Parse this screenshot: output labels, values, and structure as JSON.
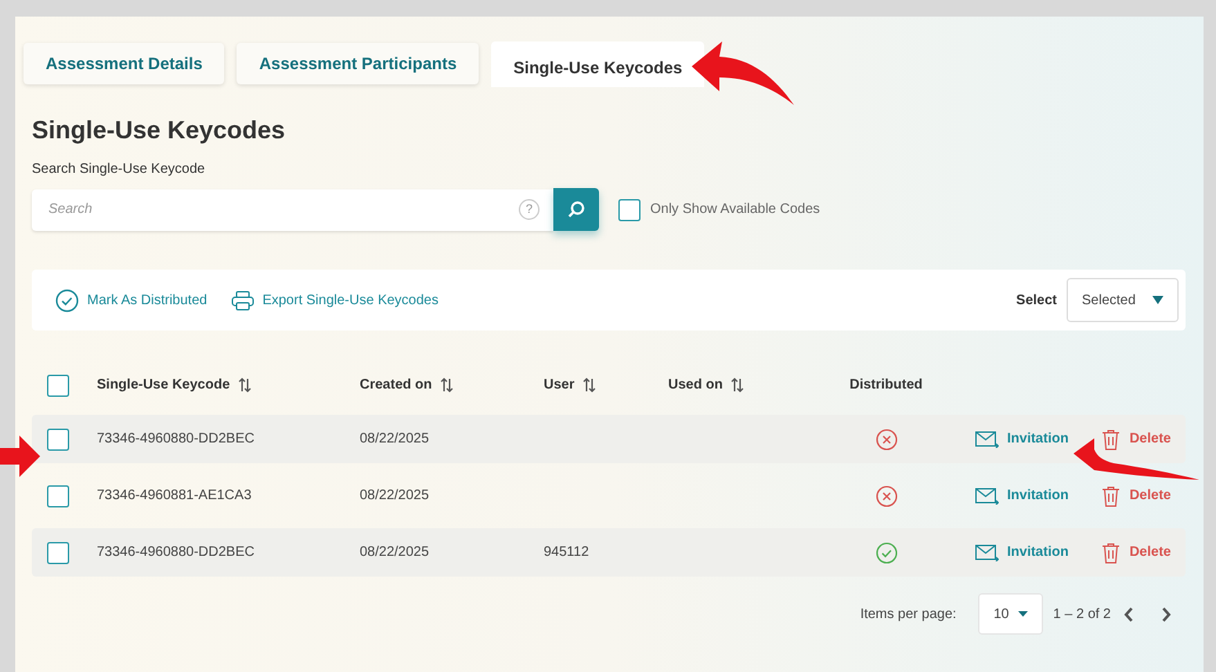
{
  "tabs": [
    {
      "label": "Assessment Details",
      "selected": false
    },
    {
      "label": "Assessment Participants",
      "selected": false
    },
    {
      "label": "Single-Use Keycodes",
      "selected": true
    }
  ],
  "title": "Single-Use Keycodes",
  "search": {
    "label": "Search Single-Use Keycode",
    "placeholder": "Search",
    "help": "?"
  },
  "only_available": {
    "label": "Only Show Available Codes",
    "checked": false
  },
  "toolbar": {
    "actions": [
      {
        "kind": "check",
        "label": "Mark As Distributed"
      },
      {
        "kind": "print",
        "label": "Export Single-Use Keycodes"
      }
    ],
    "select_label": "Select",
    "select_value": "Selected"
  },
  "table": {
    "select_all_checked": false,
    "columns": [
      {
        "label": "Single-Use Keycode",
        "sortable": true
      },
      {
        "label": "Created on",
        "sortable": true
      },
      {
        "label": "User",
        "sortable": true
      },
      {
        "label": "Used on",
        "sortable": true
      },
      {
        "label": "Distributed",
        "sortable": false
      }
    ],
    "rows": [
      {
        "checked": false,
        "keycode": "73346-4960880-DD2BEC",
        "created_on": "08/22/2025",
        "user": "",
        "distributed": false,
        "invitation": "Invitation",
        "delete": "Delete"
      },
      {
        "checked": false,
        "keycode": "73346-4960881-AE1CA3",
        "created_on": "08/22/2025",
        "user": "",
        "distributed": false,
        "invitation": "Invitation",
        "delete": "Delete"
      },
      {
        "checked": false,
        "keycode": "73346-4960880-DD2BEC",
        "created_on": "08/22/2025",
        "user": "945112",
        "distributed": true,
        "invitation": "Invitation",
        "delete": "Delete"
      }
    ]
  },
  "pagination": {
    "items_per_page_label": "Items per page:",
    "page_size": "10",
    "range": "1 – 2 of 2"
  }
}
